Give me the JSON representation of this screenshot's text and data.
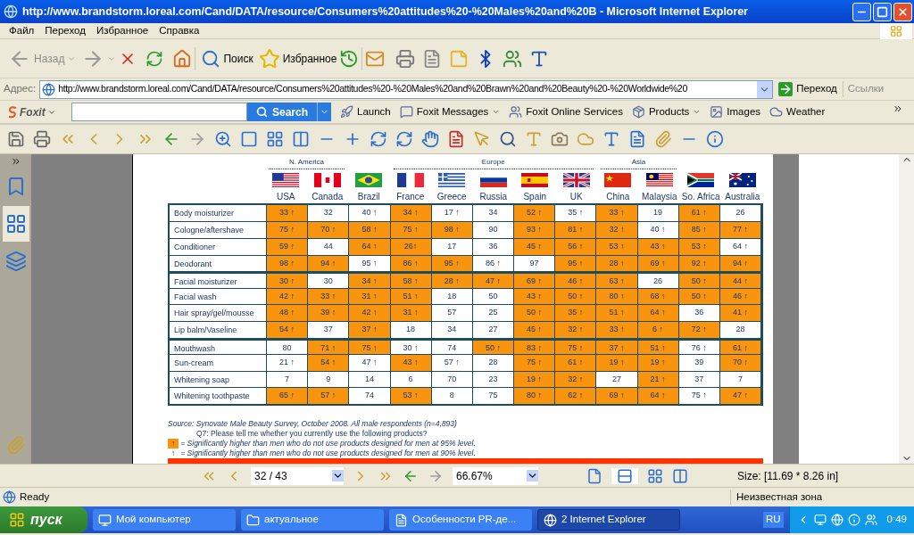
{
  "window": {
    "title": "http://www.brandstorm.loreal.com/Cand/DATA/resource/Consumers%20attitudes%20-%20Males%20and%20B - Microsoft Internet Explorer"
  },
  "menu": [
    "Файл",
    "Переход",
    "Избранное",
    "Справка"
  ],
  "toolbar": {
    "back": "Назад",
    "search": "Поиск",
    "favorites": "Избранное"
  },
  "address": {
    "label": "Адрес:",
    "url": "http://www.brandstorm.loreal.com/Cand/DATA/resource/Consumers%20attitudes%20-%20Males%20and%20Brawn%20and%20Beauty%20-%20Worldwide%20",
    "go": "Переход",
    "links": "Ссылки"
  },
  "foxit_bar": {
    "brand": "Foxit",
    "search_button": "Search",
    "items": [
      "Launch",
      "Foxit Messages",
      "Foxit Online Services",
      "Products",
      "Images",
      "Weather"
    ]
  },
  "document": {
    "groups": [
      {
        "label": "N. America"
      },
      {
        "label": "Europe"
      },
      {
        "label": "Asia"
      }
    ],
    "columns": [
      "USA",
      "Canada",
      "Brazil",
      "France",
      "Greece",
      "Russia",
      "Spain",
      "UK",
      "China",
      "Malaysia",
      "So. Africa",
      "Australia"
    ],
    "rows": [
      {
        "label": "Body moisturizer",
        "group_start": false,
        "cells": [
          {
            "text": "33 ↑",
            "highlighted": true
          },
          {
            "text": "32",
            "highlighted": false
          },
          {
            "text": "40 ↑",
            "highlighted": false
          },
          {
            "text": "34 ↑",
            "highlighted": true
          },
          {
            "text": "17 ↑",
            "highlighted": false
          },
          {
            "text": "34",
            "highlighted": false
          },
          {
            "text": "52 ↑",
            "highlighted": true
          },
          {
            "text": "35 ↑",
            "highlighted": false
          },
          {
            "text": "33 ↑",
            "highlighted": true
          },
          {
            "text": "19",
            "highlighted": false
          },
          {
            "text": "61 ↑",
            "highlighted": true
          },
          {
            "text": "26",
            "highlighted": false
          }
        ]
      },
      {
        "label": "Cologne/aftershave",
        "group_start": false,
        "cells": [
          {
            "text": "75 ↑",
            "highlighted": true
          },
          {
            "text": "70 ↑",
            "highlighted": true
          },
          {
            "text": "58 ↑",
            "highlighted": true
          },
          {
            "text": "75 ↑",
            "highlighted": true
          },
          {
            "text": "98 ↑",
            "highlighted": true
          },
          {
            "text": "90",
            "highlighted": false
          },
          {
            "text": "93 ↑",
            "highlighted": true
          },
          {
            "text": "81 ↑",
            "highlighted": true
          },
          {
            "text": "32 ↑",
            "highlighted": true
          },
          {
            "text": "40 ↑",
            "highlighted": false
          },
          {
            "text": "85 ↑",
            "highlighted": true
          },
          {
            "text": "77 ↑",
            "highlighted": true
          }
        ]
      },
      {
        "label": "Conditioner",
        "group_start": false,
        "cells": [
          {
            "text": "59 ↑",
            "highlighted": true
          },
          {
            "text": "44",
            "highlighted": false
          },
          {
            "text": "64 ↑",
            "highlighted": true
          },
          {
            "text": "26↑",
            "highlighted": true
          },
          {
            "text": "17",
            "highlighted": false
          },
          {
            "text": "36",
            "highlighted": false
          },
          {
            "text": "45 ↑",
            "highlighted": true
          },
          {
            "text": "56 ↑",
            "highlighted": true
          },
          {
            "text": "53 ↑",
            "highlighted": true
          },
          {
            "text": "43 ↑",
            "highlighted": true
          },
          {
            "text": "53 ↑",
            "highlighted": true
          },
          {
            "text": "64 ↑",
            "highlighted": false
          }
        ]
      },
      {
        "label": "Deodorant",
        "group_start": false,
        "cells": [
          {
            "text": "98 ↑",
            "highlighted": true
          },
          {
            "text": "94 ↑",
            "highlighted": true
          },
          {
            "text": "95 ↑",
            "highlighted": false
          },
          {
            "text": "86 ↑",
            "highlighted": true
          },
          {
            "text": "95 ↑",
            "highlighted": true
          },
          {
            "text": "86 ↑",
            "highlighted": false
          },
          {
            "text": "97",
            "highlighted": false
          },
          {
            "text": "95 ↑",
            "highlighted": true
          },
          {
            "text": "28 ↑",
            "highlighted": true
          },
          {
            "text": "69 ↑",
            "highlighted": true
          },
          {
            "text": "92 ↑",
            "highlighted": true
          },
          {
            "text": "94 ↑",
            "highlighted": true
          }
        ]
      },
      {
        "label": "Facial moisturizer",
        "group_start": true,
        "cells": [
          {
            "text": "30 ↑",
            "highlighted": true
          },
          {
            "text": "30",
            "highlighted": false
          },
          {
            "text": "34 ↑",
            "highlighted": true
          },
          {
            "text": "58 ↑",
            "highlighted": true
          },
          {
            "text": "28 ↑",
            "highlighted": true
          },
          {
            "text": "47 ↑",
            "highlighted": true
          },
          {
            "text": "69 ↑",
            "highlighted": true
          },
          {
            "text": "46 ↑",
            "highlighted": true
          },
          {
            "text": "63 ↑",
            "highlighted": true
          },
          {
            "text": "26",
            "highlighted": false
          },
          {
            "text": "50 ↑",
            "highlighted": true
          },
          {
            "text": "44 ↑",
            "highlighted": true
          }
        ]
      },
      {
        "label": "Facial wash",
        "group_start": false,
        "cells": [
          {
            "text": "42 ↑",
            "highlighted": true
          },
          {
            "text": "33 ↑",
            "highlighted": true
          },
          {
            "text": "31 ↑",
            "highlighted": true
          },
          {
            "text": "51 ↑",
            "highlighted": true
          },
          {
            "text": "18",
            "highlighted": false
          },
          {
            "text": "50",
            "highlighted": false
          },
          {
            "text": "43 ↑",
            "highlighted": true
          },
          {
            "text": "50 ↑",
            "highlighted": true
          },
          {
            "text": "80 ↑",
            "highlighted": true
          },
          {
            "text": "68 ↑",
            "highlighted": true
          },
          {
            "text": "50 ↑",
            "highlighted": true
          },
          {
            "text": "46 ↑",
            "highlighted": true
          }
        ]
      },
      {
        "label": "Hair spray/gel/mousse",
        "group_start": false,
        "cells": [
          {
            "text": "48 ↑",
            "highlighted": true
          },
          {
            "text": "39 ↑",
            "highlighted": true
          },
          {
            "text": "42 ↑",
            "highlighted": true
          },
          {
            "text": "31 ↑",
            "highlighted": true
          },
          {
            "text": "57",
            "highlighted": false
          },
          {
            "text": "25",
            "highlighted": false
          },
          {
            "text": "50 ↑",
            "highlighted": true
          },
          {
            "text": "35 ↑",
            "highlighted": true
          },
          {
            "text": "51 ↑",
            "highlighted": true
          },
          {
            "text": "64 ↑",
            "highlighted": true
          },
          {
            "text": "36",
            "highlighted": false
          },
          {
            "text": "41 ↑",
            "highlighted": true
          }
        ]
      },
      {
        "label": "Lip balm/Vaseline",
        "group_start": false,
        "cells": [
          {
            "text": "54 ↑",
            "highlighted": true
          },
          {
            "text": "37",
            "highlighted": false
          },
          {
            "text": "37 ↑",
            "highlighted": true
          },
          {
            "text": "18",
            "highlighted": false
          },
          {
            "text": "34",
            "highlighted": false
          },
          {
            "text": "27",
            "highlighted": false
          },
          {
            "text": "45 ↑",
            "highlighted": true
          },
          {
            "text": "32 ↑",
            "highlighted": true
          },
          {
            "text": "33 ↑",
            "highlighted": true
          },
          {
            "text": "6 ↑",
            "highlighted": true
          },
          {
            "text": "72 ↑",
            "highlighted": true
          },
          {
            "text": "28",
            "highlighted": false
          }
        ]
      },
      {
        "label": "Mouthwash",
        "group_start": true,
        "cells": [
          {
            "text": "80",
            "highlighted": false
          },
          {
            "text": "71 ↑",
            "highlighted": true
          },
          {
            "text": "75 ↑",
            "highlighted": true
          },
          {
            "text": "30 ↑",
            "highlighted": false
          },
          {
            "text": "74",
            "highlighted": false
          },
          {
            "text": "50 ↑",
            "highlighted": true
          },
          {
            "text": "83 ↑",
            "highlighted": true
          },
          {
            "text": "75 ↑",
            "highlighted": true
          },
          {
            "text": "37 ↑",
            "highlighted": true
          },
          {
            "text": "51 ↑",
            "highlighted": true
          },
          {
            "text": "76 ↑",
            "highlighted": false
          },
          {
            "text": "61 ↑",
            "highlighted": true
          }
        ]
      },
      {
        "label": "Sun-cream",
        "group_start": false,
        "cells": [
          {
            "text": "21 ↑",
            "highlighted": false
          },
          {
            "text": "54 ↑",
            "highlighted": true
          },
          {
            "text": "47 ↑",
            "highlighted": false
          },
          {
            "text": "43 ↑",
            "highlighted": true
          },
          {
            "text": "57 ↑",
            "highlighted": false
          },
          {
            "text": "28",
            "highlighted": false
          },
          {
            "text": "75 ↑",
            "highlighted": true
          },
          {
            "text": "61 ↑",
            "highlighted": true
          },
          {
            "text": "19 ↑",
            "highlighted": true
          },
          {
            "text": "19 ↑",
            "highlighted": true
          },
          {
            "text": "39",
            "highlighted": false
          },
          {
            "text": "70 ↑",
            "highlighted": true
          }
        ]
      },
      {
        "label": "Whitening soap",
        "group_start": false,
        "cells": [
          {
            "text": "7",
            "highlighted": false
          },
          {
            "text": "9",
            "highlighted": false
          },
          {
            "text": "14",
            "highlighted": false
          },
          {
            "text": "6",
            "highlighted": false
          },
          {
            "text": "70",
            "highlighted": false
          },
          {
            "text": "23",
            "highlighted": false
          },
          {
            "text": "19 ↑",
            "highlighted": true
          },
          {
            "text": "32 ↑",
            "highlighted": true
          },
          {
            "text": "27",
            "highlighted": false
          },
          {
            "text": "21 ↑",
            "highlighted": true
          },
          {
            "text": "37",
            "highlighted": false
          },
          {
            "text": "7",
            "highlighted": false
          }
        ]
      },
      {
        "label": "Whitening toothpaste",
        "group_start": false,
        "cells": [
          {
            "text": "65 ↑",
            "highlighted": true
          },
          {
            "text": "57 ↑",
            "highlighted": true
          },
          {
            "text": "74",
            "highlighted": false
          },
          {
            "text": "53 ↑",
            "highlighted": true
          },
          {
            "text": "8",
            "highlighted": false
          },
          {
            "text": "75",
            "highlighted": false
          },
          {
            "text": "80 ↑",
            "highlighted": true
          },
          {
            "text": "62 ↑",
            "highlighted": true
          },
          {
            "text": "69 ↑",
            "highlighted": true
          },
          {
            "text": "64 ↑",
            "highlighted": true
          },
          {
            "text": "75 ↑",
            "highlighted": false
          },
          {
            "text": "47 ↑",
            "highlighted": true
          }
        ]
      }
    ],
    "source": "Source: Synovate Male Beauty Survey, October 2008.  All male respondents (n=4,893)",
    "question": "Q7: Please tell me whether you currently use the following products?",
    "legend": [
      {
        "marker": "↑",
        "highlighted": true,
        "text": "= Significantly higher than men who do not use products designed for men at 95% level."
      },
      {
        "marker": "↑",
        "highlighted": false,
        "text": "= Significantly higher than men who do not use products designed for men at 90% level."
      }
    ]
  },
  "pdf_nav": {
    "page": "32 / 43",
    "zoom": "66.67%",
    "size": "Size: [11.69 * 8.26 in]"
  },
  "status_bar": {
    "status": "Ready",
    "zone": "Неизвестная зона"
  },
  "taskbar": {
    "start": "пуск",
    "tasks": [
      {
        "label": "Мой компьютер",
        "selected": false
      },
      {
        "label": "актуальное",
        "selected": false
      },
      {
        "label": "Особенности PR-де...",
        "selected": false
      },
      {
        "label": "2 Internet Explorer",
        "selected": true
      }
    ],
    "language": "RU",
    "clock": "0:49"
  }
}
